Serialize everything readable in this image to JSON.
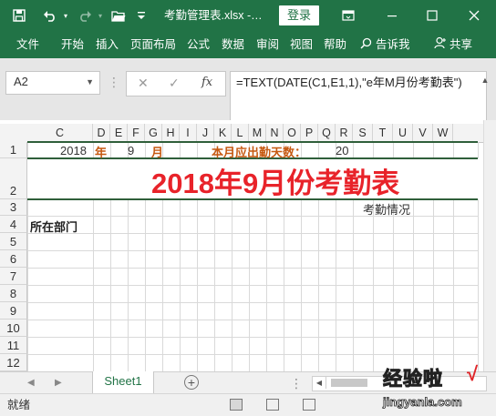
{
  "titlebar": {
    "filename": "考勤管理表.xlsx  -…",
    "login_label": "登录",
    "icons": [
      "save-icon",
      "undo-icon",
      "redo-icon",
      "folder-open-icon",
      "customize-toolbar-icon",
      "ribbon-display-icon",
      "minimize-icon",
      "maximize-icon",
      "close-icon"
    ]
  },
  "ribbon_tabs": [
    "文件",
    "开始",
    "插入",
    "页面布局",
    "公式",
    "数据",
    "审阅",
    "视图",
    "帮助"
  ],
  "tell_me": "告诉我",
  "share": "共享",
  "formula_bar": {
    "cell_ref": "A2",
    "formula": "=TEXT(DATE(C1,E1,1),\"e年M月份考勤表\")",
    "fx_label": "fx"
  },
  "columns": [
    "C",
    "D",
    "E",
    "F",
    "G",
    "H",
    "I",
    "J",
    "K",
    "L",
    "M",
    "N",
    "O",
    "P",
    "Q",
    "R",
    "S",
    "T",
    "U",
    "V",
    "W"
  ],
  "rows": [
    "1",
    "2",
    "3",
    "4",
    "5",
    "6",
    "7",
    "8",
    "9",
    "10",
    "11",
    "12"
  ],
  "cells": {
    "C1": "2018",
    "D1": "年",
    "F1": "9",
    "G1": "月",
    "K1": "本月应出勤天数：",
    "P1": "20",
    "A2": "2018年9月份考勤表",
    "R3": "考勤情况",
    "A4": "所在部门"
  },
  "sheet_tab": "Sheet1",
  "status": "就绪",
  "colors": {
    "excel_green": "#217346",
    "title_red": "#e8232a",
    "label_orange": "#c65911"
  },
  "watermark": {
    "main": "经验啦",
    "check": "√",
    "url": "jingyanla.com"
  }
}
